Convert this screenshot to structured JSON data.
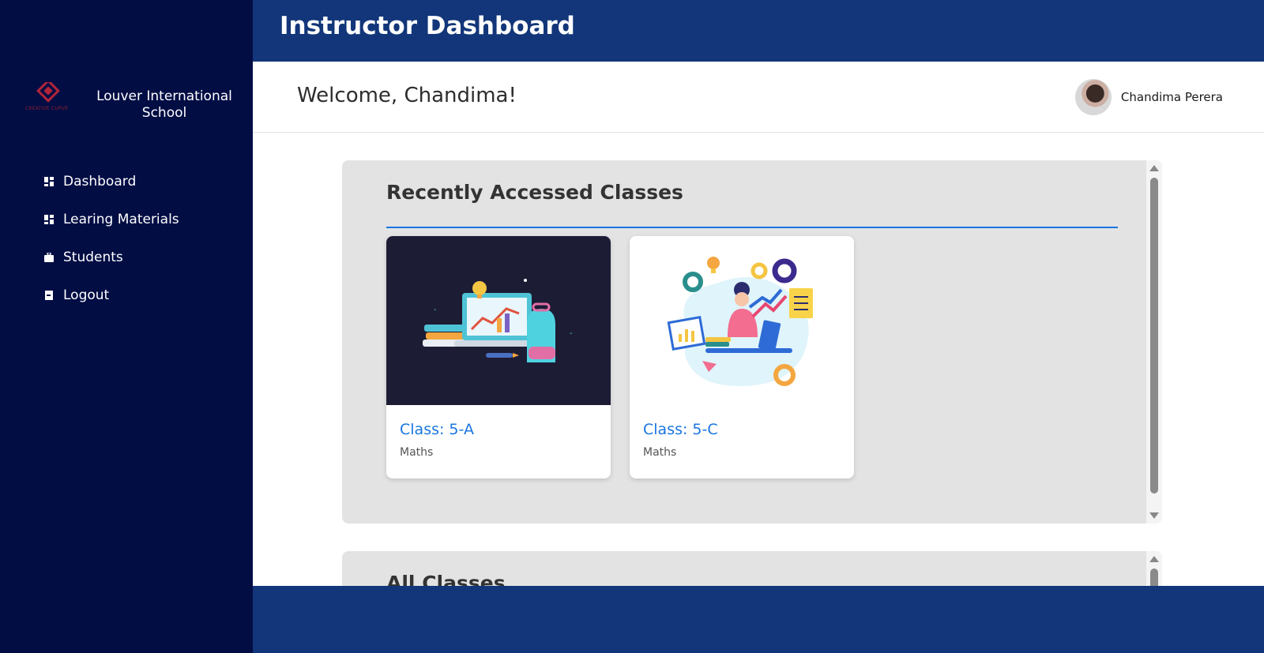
{
  "sidebar": {
    "logo_text": "CREATIVE CURVE",
    "school_name": "Louver International School",
    "items": [
      {
        "label": "Dashboard",
        "icon": "dashboard-grid-icon"
      },
      {
        "label": "Learing Materials",
        "icon": "dashboard-grid-icon"
      },
      {
        "label": "Students",
        "icon": "briefcase-icon"
      },
      {
        "label": "Logout",
        "icon": "logout-door-icon"
      }
    ]
  },
  "header": {
    "title": "Instructor Dashboard"
  },
  "welcome": {
    "text": "Welcome, Chandima!",
    "user_name": "Chandima Perera"
  },
  "recent": {
    "title": "Recently Accessed Classes",
    "classes": [
      {
        "title": "Class: 5-A",
        "subject": "Maths"
      },
      {
        "title": "Class: 5-C",
        "subject": "Maths"
      }
    ]
  },
  "all_classes": {
    "title": "All Classes"
  },
  "colors": {
    "sidebar": "#020d44",
    "header": "#123679",
    "accent": "#1976e0",
    "panel": "#e3e3e3"
  }
}
